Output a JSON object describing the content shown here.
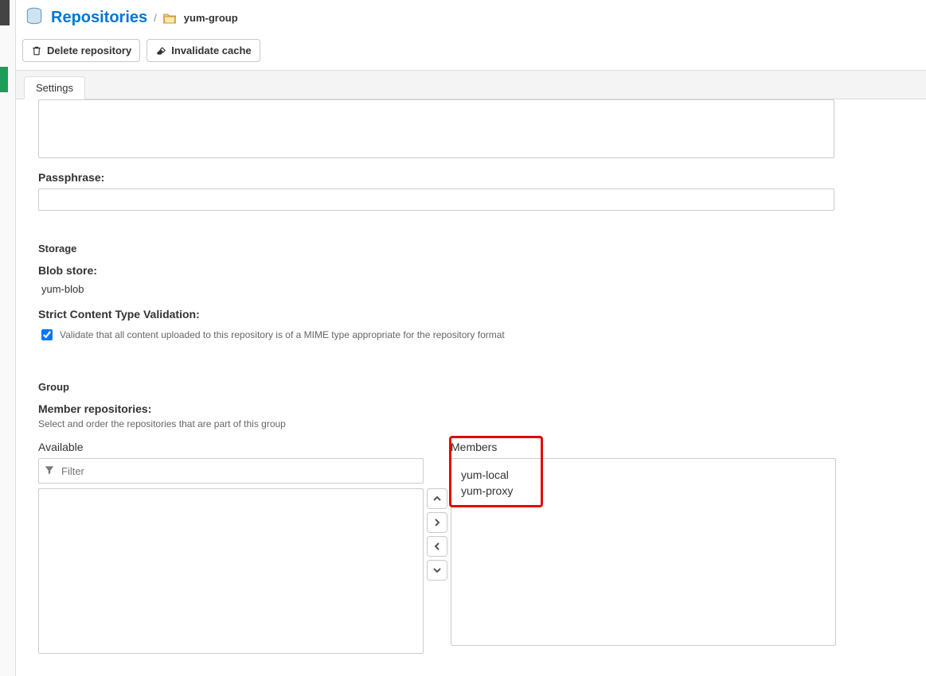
{
  "header": {
    "title": "Repositories",
    "breadcrumb_name": "yum-group"
  },
  "actions": {
    "delete": "Delete repository",
    "invalidate": "Invalidate cache"
  },
  "tabs": {
    "settings": "Settings"
  },
  "form": {
    "passphrase_label": "Passphrase:",
    "storage_heading": "Storage",
    "blob_store_label": "Blob store:",
    "blob_store_value": "yum-blob",
    "strict_label": "Strict Content Type Validation:",
    "strict_checked": true,
    "strict_help": "Validate that all content uploaded to this repository is of a MIME type appropriate for the repository format",
    "group_heading": "Group",
    "member_repos_label": "Member repositories:",
    "member_repos_help": "Select and order the repositories that are part of this group"
  },
  "dual": {
    "available_label": "Available",
    "members_label": "Members",
    "filter_placeholder": "Filter",
    "members": [
      "yum-local",
      "yum-proxy"
    ]
  }
}
